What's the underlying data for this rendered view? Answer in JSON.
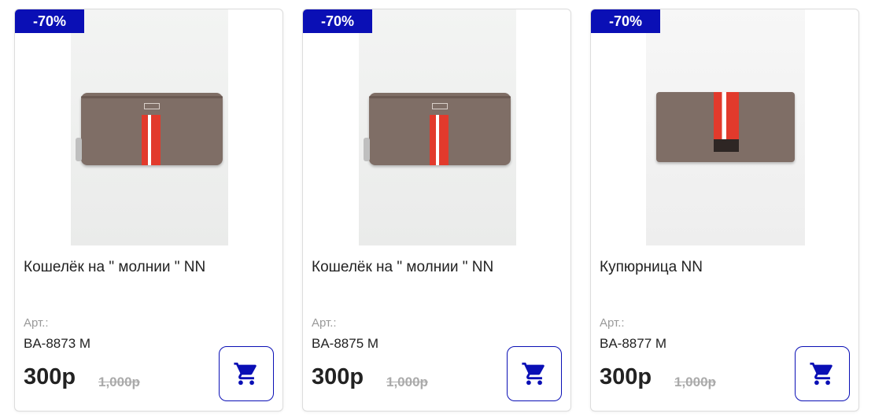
{
  "theme": {
    "accent": "#0a0fb5"
  },
  "products": [
    {
      "discount": "-70%",
      "title": "Кошелёк на \" молнии \" NN",
      "sku_label": "Арт.:",
      "sku": "BA-8873 M",
      "price": "300р",
      "old_price": "1,000р",
      "cart_icon": "shopping-cart-icon"
    },
    {
      "discount": "-70%",
      "title": "Кошелёк на \" молнии \" NN",
      "sku_label": "Арт.:",
      "sku": "BA-8875 M",
      "price": "300р",
      "old_price": "1,000р",
      "cart_icon": "shopping-cart-icon"
    },
    {
      "discount": "-70%",
      "title": "Купюрница NN",
      "sku_label": "Арт.:",
      "sku": "BA-8877 M",
      "price": "300р",
      "old_price": "1,000р",
      "cart_icon": "shopping-cart-icon"
    }
  ]
}
